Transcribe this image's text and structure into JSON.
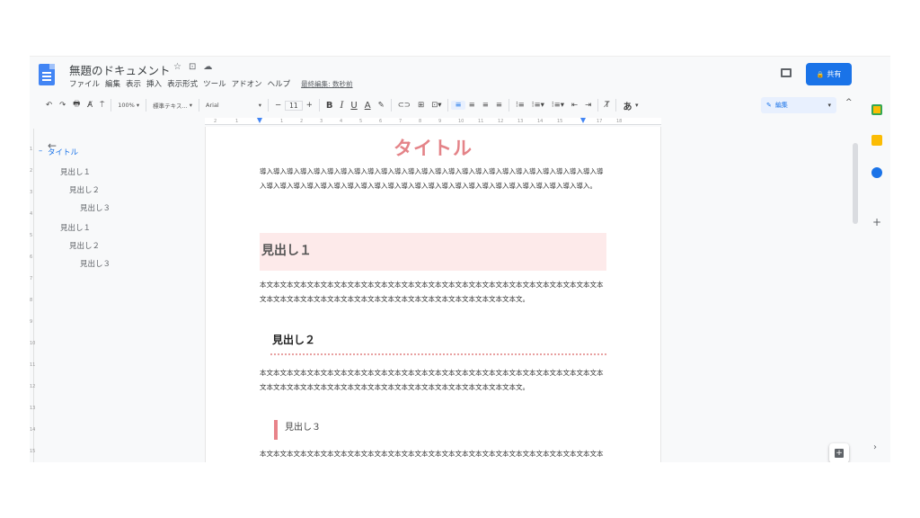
{
  "header": {
    "doc_title": "無題のドキュメント",
    "title_icons": [
      "☆",
      "⊡",
      "☁"
    ],
    "menus": [
      "ファイル",
      "編集",
      "表示",
      "挿入",
      "表示形式",
      "ツール",
      "アドオン",
      "ヘルプ"
    ],
    "last_edit": "最終編集: 数秒前",
    "share_label": "共有",
    "share_icon": "🔒"
  },
  "toolbar": {
    "undo": "↶",
    "redo": "↷",
    "print": "🖶",
    "spell": "A̸",
    "paint": "⍑",
    "zoom": "100%",
    "dropdown": "▾",
    "style": "標準テキス...",
    "font": "Arial",
    "minus": "−",
    "size": "11",
    "plus": "+",
    "bold": "B",
    "italic": "I",
    "underline": "U",
    "color": "A",
    "highlight": "✎",
    "link": "⊂⊃",
    "comment": "⊞",
    "image": "⊡",
    "align_left": "≡",
    "align_center": "≡",
    "align_right": "≡",
    "align_justify": "≡",
    "line_spacing": "⁝≡",
    "checklist": "⁝≡",
    "bullets": "⁝≡",
    "numbering": "⁝≡",
    "indent_less": "⇤",
    "indent_more": "⇥",
    "clear": "T̸",
    "input_tools": "あ",
    "edit_mode": "編集",
    "collapse": "^"
  },
  "ruler": {
    "labels": [
      "2",
      "1",
      "1",
      "2",
      "3",
      "4",
      "5",
      "6",
      "7",
      "8",
      "9",
      "10",
      "11",
      "12",
      "13",
      "14",
      "15",
      "17",
      "18"
    ]
  },
  "vruler": {
    "labels": [
      "1",
      "2",
      "3",
      "4",
      "5",
      "6",
      "7",
      "8",
      "9",
      "10",
      "11",
      "12",
      "13",
      "14",
      "15"
    ]
  },
  "outline": {
    "back": "←",
    "items": [
      {
        "text": "タイトル",
        "level": 0,
        "selected": true
      },
      {
        "text": "見出し１",
        "level": 1
      },
      {
        "text": "見出し２",
        "level": 2
      },
      {
        "text": "見出し３",
        "level": 3
      },
      {
        "text": "見出し１",
        "level": 1
      },
      {
        "text": "見出し２",
        "level": 2
      },
      {
        "text": "見出し３",
        "level": 3
      }
    ]
  },
  "page": {
    "title": "タイトル",
    "intro": "導入導入導入導入導入導入導入導入導入導入導入導入導入導入導入導入導入導入導入導入導入導入導入導入導入導入導入導入導入導入導入導入導入導入導入導入導入導入導入導入導入導入導入導入導入導入導入導入導入導入。",
    "h1": "見出し１",
    "body1": "本文本文本文本文本文本文本文本文本文本文本文本文本文本文本文本文本文本文本文本文本文本文本文本文本文本文本文本文本文本文本文本文本文本文本文本文本文本文本文本文本文本文本文本文本文。",
    "h2": "見出し２",
    "body2": "本文本文本文本文本文本文本文本文本文本文本文本文本文本文本文本文本文本文本文本文本文本文本文本文本文本文本文本文本文本文本文本文本文本文本文本文本文本文本文本文本文本文本文本文本文。",
    "h3": "見出し３",
    "body3": "本文本文本文本文本文本文本文本文本文本文本文本文本文本文本文本文本文本文本文本文本文本文本文本文本文本文本文本文本文本文本文本文本文"
  },
  "side": {
    "plus": "+",
    "chevron": "›"
  },
  "colors": {
    "title": "#e48388",
    "h1_bg": "#fdeaea",
    "h3_bar": "#e8838a",
    "accent": "#1a73e8"
  }
}
